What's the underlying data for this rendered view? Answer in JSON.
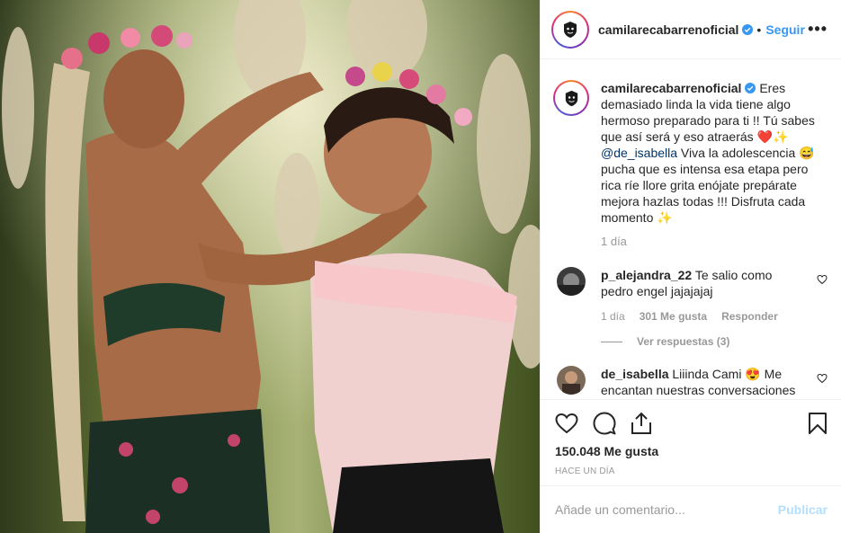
{
  "post": {
    "author": "camilarecabarrenoficial",
    "follow_label": "Seguir",
    "more_label": "•••",
    "accent_color": "#3897f0"
  },
  "caption": {
    "username": "camilarecabarrenoficial",
    "text_1": "Eres demasiado linda la vida tiene algo hermoso preparado para ti !! Tú sabes que así será y eso atraerás ",
    "emoji_1": "❤️✨",
    "mention": "@de_isabella",
    "text_2": " Viva la adolescencia ",
    "emoji_2": "😅",
    "text_3": " pucha que es intensa esa etapa pero rica ríe llore grita enójate prepárate mejora hazlas todas !!! Disfruta cada momento ",
    "emoji_3": "✨",
    "time": "1 día"
  },
  "comments": [
    {
      "username": "p_alejandra_22",
      "text": "Te salio como pedro engel jajajajaj",
      "time": "1 día",
      "likes": "301 Me gusta",
      "reply_label": "Responder",
      "view_replies": "Ver respuestas (3)"
    },
    {
      "username": "de_isabella",
      "text_1": "Liiinda Cami ",
      "emoji": "😍",
      "text_2": " Me encantan nuestras conversaciones"
    }
  ],
  "actions": {
    "like_icon": "heart-outline-icon",
    "comment_icon": "speech-bubble-icon",
    "share_icon": "share-upload-icon",
    "save_icon": "bookmark-icon",
    "likes_count": "150.048 Me gusta",
    "time_ago": "Hace un día"
  },
  "add_comment": {
    "placeholder": "Añade un comentario...",
    "publish_label": "Publicar",
    "publish_color": "#b2dffc"
  }
}
